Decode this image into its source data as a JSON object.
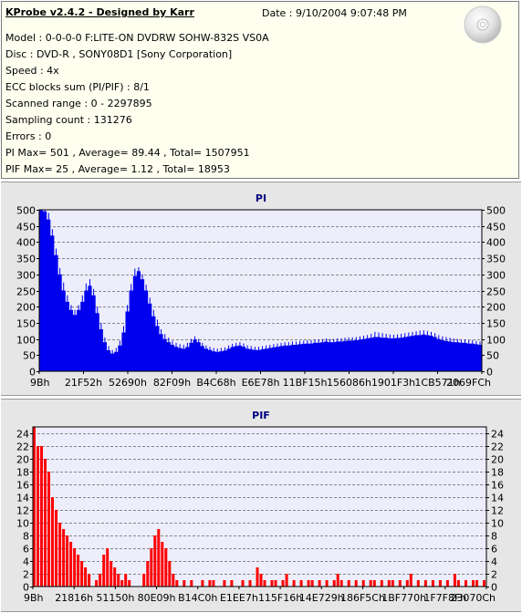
{
  "header": {
    "title": "KProbe v2.4.2 - Designed by Karr",
    "date": "Date : 9/10/2004 9:07:48 PM",
    "lines": [
      "Model : 0-0-0-0 F:LITE-ON DVDRW SOHW-832S  VS0A",
      "Disc : DVD-R , SONY08D1 [Sony Corporation]",
      "Speed : 4x",
      "ECC blocks sum (PI/PIF) : 8/1",
      "Scanned range : 0 - 2297895",
      "Sampling count : 131276",
      "Errors : 0",
      "PI Max= 501 , Average= 89.44 , Total= 1507951",
      "PIF Max= 25 , Average= 1.12 , Total= 18953"
    ]
  },
  "colors": {
    "info_background": "#fffff0",
    "panel_background": "#e6e6e6",
    "plot_background": "#ededfb",
    "pi_fill": "#0000ee",
    "pif_fill": "#ff0000",
    "pi_title": "#000080",
    "pif_title": "#000080",
    "grid": "#888888"
  },
  "chart_data": [
    {
      "id": "pi",
      "type": "area",
      "title": "PI",
      "ylim": [
        0,
        500
      ],
      "yticks": [
        0,
        50,
        100,
        150,
        200,
        250,
        300,
        350,
        400,
        450,
        500
      ],
      "x_tick_labels": [
        "9Bh",
        "21F52h",
        "52690h",
        "82F09h",
        "B4C68h",
        "E6E78h",
        "11BF15h",
        "156086h",
        "1901F3h",
        "1CB571h",
        "2069FCh"
      ],
      "grid": true,
      "series": [
        {
          "values": [
            500,
            495,
            470,
            420,
            360,
            300,
            250,
            215,
            190,
            175,
            190,
            215,
            250,
            265,
            235,
            180,
            130,
            90,
            65,
            55,
            60,
            80,
            120,
            185,
            250,
            295,
            310,
            285,
            250,
            210,
            170,
            140,
            115,
            100,
            90,
            82,
            76,
            72,
            70,
            75,
            88,
            98,
            90,
            78,
            70,
            66,
            62,
            60,
            62,
            64,
            70,
            75,
            78,
            80,
            76,
            70,
            68,
            66,
            66,
            68,
            70,
            72,
            74,
            76,
            78,
            80,
            80,
            82,
            82,
            84,
            85,
            86,
            86,
            88,
            88,
            90,
            92,
            90,
            90,
            92,
            92,
            94,
            95,
            95,
            96,
            98,
            100,
            102,
            104,
            106,
            106,
            104,
            104,
            102,
            102,
            103,
            104,
            106,
            108,
            110,
            112,
            112,
            114,
            112,
            110,
            106,
            100,
            96,
            94,
            92,
            90,
            90,
            88,
            88,
            86,
            86,
            84,
            82
          ],
          "peaks": [
            501,
            500,
            490,
            440,
            380,
            320,
            275,
            235,
            205,
            190,
            205,
            235,
            272,
            285,
            255,
            200,
            150,
            105,
            78,
            66,
            72,
            95,
            140,
            205,
            270,
            318,
            322,
            300,
            268,
            228,
            190,
            160,
            130,
            115,
            104,
            94,
            88,
            84,
            82,
            88,
            100,
            108,
            100,
            88,
            80,
            76,
            72,
            70,
            72,
            74,
            80,
            85,
            88,
            90,
            86,
            80,
            78,
            76,
            76,
            78,
            80,
            82,
            84,
            86,
            88,
            90,
            90,
            92,
            92,
            94,
            95,
            96,
            96,
            98,
            98,
            100,
            102,
            100,
            100,
            102,
            102,
            104,
            105,
            105,
            106,
            108,
            110,
            112,
            116,
            122,
            120,
            118,
            116,
            114,
            113,
            114,
            116,
            118,
            120,
            122,
            124,
            126,
            127,
            125,
            122,
            118,
            112,
            108,
            106,
            104,
            102,
            100,
            98,
            98,
            96,
            96,
            94,
            92
          ]
        }
      ]
    },
    {
      "id": "pif",
      "type": "bar",
      "title": "PIF",
      "ylim": [
        0,
        25
      ],
      "yticks": [
        0,
        2,
        4,
        6,
        8,
        10,
        12,
        14,
        16,
        18,
        20,
        22,
        24
      ],
      "x_tick_labels": [
        "9Bh",
        "21816h",
        "51150h",
        "80E09h",
        "B14C0h",
        "E1EE7h",
        "115F16h",
        "14E729h",
        "186F5Ch",
        "1BF770h",
        "1F7F8Fh",
        "23070Ch"
      ],
      "grid": true,
      "series": [
        {
          "values": [
            25,
            22,
            22,
            20,
            18,
            14,
            12,
            10,
            9,
            8,
            7,
            6,
            5,
            4,
            3,
            2,
            0,
            1,
            2,
            5,
            6,
            4,
            3,
            2,
            1,
            2,
            1,
            0,
            0,
            0,
            2,
            4,
            6,
            8,
            9,
            7,
            6,
            4,
            2,
            1,
            0,
            1,
            0,
            1,
            0,
            0,
            1,
            0,
            1,
            1,
            0,
            0,
            1,
            0,
            1,
            0,
            0,
            1,
            0,
            1,
            0,
            3,
            2,
            1,
            0,
            1,
            1,
            0,
            1,
            2,
            0,
            1,
            0,
            1,
            0,
            1,
            1,
            0,
            1,
            0,
            1,
            0,
            1,
            2,
            1,
            0,
            1,
            0,
            1,
            0,
            1,
            0,
            1,
            1,
            0,
            1,
            0,
            1,
            1,
            0,
            1,
            0,
            1,
            2,
            0,
            1,
            0,
            1,
            0,
            1,
            0,
            1,
            0,
            1,
            0,
            2,
            1,
            0,
            1,
            0,
            1,
            1,
            0,
            1
          ]
        }
      ]
    }
  ]
}
